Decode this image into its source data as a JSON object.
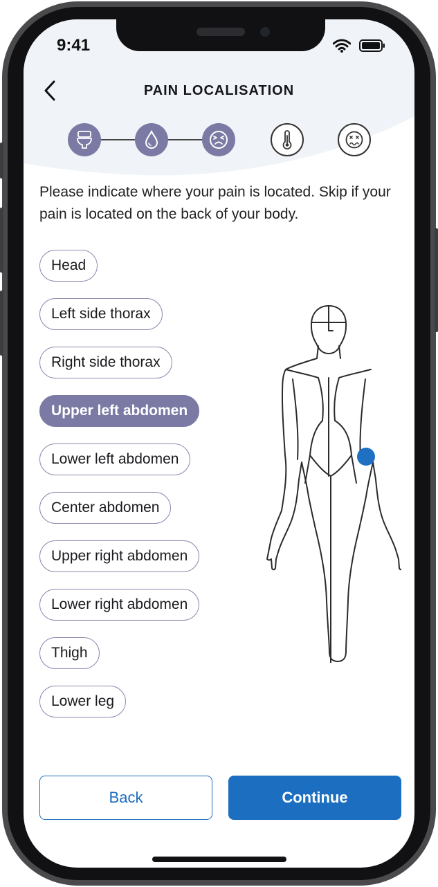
{
  "status_bar": {
    "time": "9:41"
  },
  "header": {
    "title": "PAIN LOCALISATION"
  },
  "stepper": {
    "steps": [
      {
        "icon": "toilet-icon",
        "state": "done"
      },
      {
        "icon": "drop-icon",
        "state": "done"
      },
      {
        "icon": "pain-face-icon",
        "state": "current"
      },
      {
        "icon": "thermometer-icon",
        "state": "todo"
      },
      {
        "icon": "nausea-face-icon",
        "state": "todo"
      }
    ]
  },
  "instruction": "Please indicate where your pain is located. Skip if your pain is located on the back of your body.",
  "locations": [
    {
      "label": "Head",
      "selected": false
    },
    {
      "label": "Left side thorax",
      "selected": false
    },
    {
      "label": "Right side thorax",
      "selected": false
    },
    {
      "label": "Upper left abdomen",
      "selected": true
    },
    {
      "label": "Lower left abdomen",
      "selected": false
    },
    {
      "label": "Center abdomen",
      "selected": false
    },
    {
      "label": "Upper right abdomen",
      "selected": false
    },
    {
      "label": "Lower right abdomen",
      "selected": false
    },
    {
      "label": "Thigh",
      "selected": false
    },
    {
      "label": "Lower leg",
      "selected": false
    }
  ],
  "buttons": {
    "back": "Back",
    "continue": "Continue"
  },
  "colors": {
    "accent": "#7b7aa4",
    "primary": "#1c6fc0",
    "pain_marker": "#1f6fc2",
    "header_bg": "#f0f4f8"
  }
}
